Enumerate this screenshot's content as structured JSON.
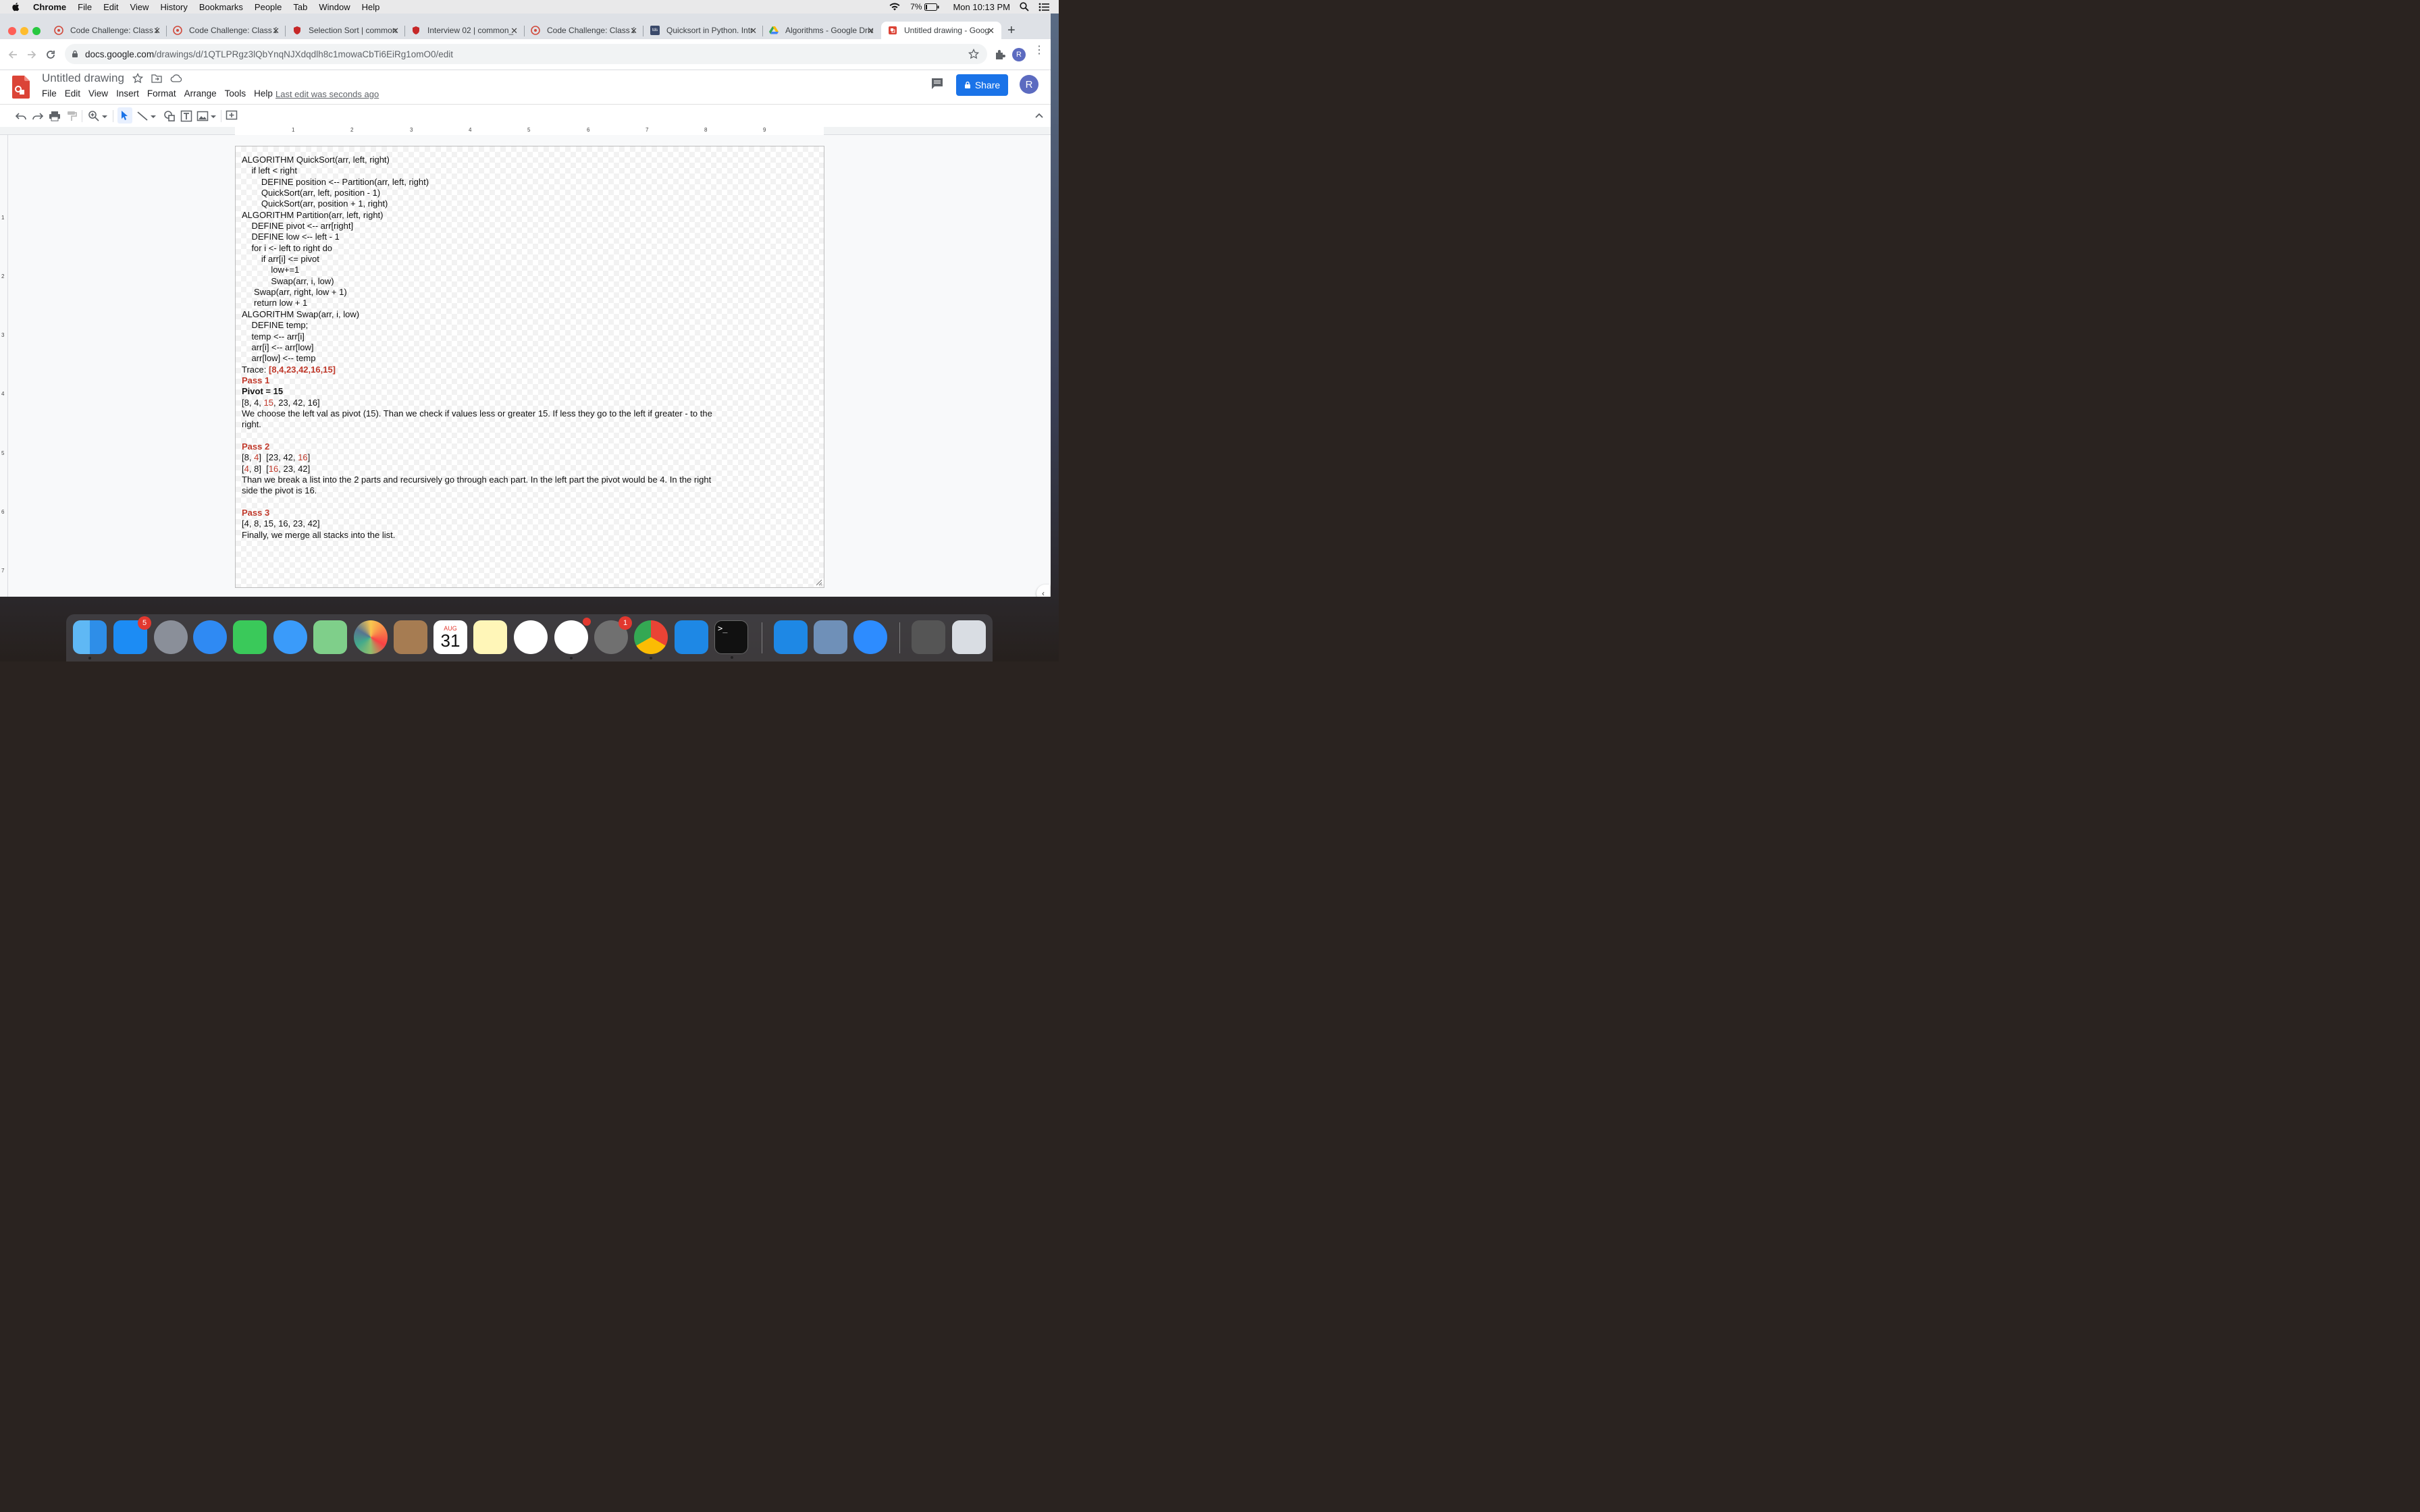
{
  "menubar": {
    "app_name": "Chrome",
    "items": [
      "File",
      "Edit",
      "View",
      "History",
      "Bookmarks",
      "People",
      "Tab",
      "Window",
      "Help"
    ],
    "battery": "7%",
    "clock": "Mon 10:13 PM"
  },
  "tabs": [
    {
      "title": "Code Challenge: Class 2"
    },
    {
      "title": "Code Challenge: Class 2"
    },
    {
      "title": "Selection Sort | common"
    },
    {
      "title": "Interview 02 | common_"
    },
    {
      "title": "Code Challenge: Class 2"
    },
    {
      "title": "Quicksort in Python. Intr"
    },
    {
      "title": "Algorithms - Google Driv"
    },
    {
      "title": "Untitled drawing - Goog"
    }
  ],
  "tab_favicon_badge": "tds",
  "address_bar": {
    "host": "docs.google.com",
    "path": "/drawings/d/1QTLPRgz3lQbYnqNJXdqdlh8c1mowaCbTi6EiRg1omO0/edit"
  },
  "profile_initial": "R",
  "docs": {
    "title": "Untitled drawing",
    "menu": [
      "File",
      "Edit",
      "View",
      "Insert",
      "Format",
      "Arrange",
      "Tools",
      "Help"
    ],
    "last_edit": "Last edit was seconds ago",
    "share_label": "Share",
    "account_initial": "R"
  },
  "ruler": {
    "h_numbers": [
      "1",
      "2",
      "3",
      "4",
      "5",
      "6",
      "7",
      "8",
      "9"
    ],
    "v_numbers": [
      "1",
      "2",
      "3",
      "4",
      "5",
      "6",
      "7"
    ]
  },
  "content": {
    "code_lines": [
      "ALGORITHM QuickSort(arr, left, right)",
      "    if left < right",
      "        DEFINE position <-- Partition(arr, left, right)",
      "        QuickSort(arr, left, position - 1)",
      "        QuickSort(arr, position + 1, right)",
      "ALGORITHM Partition(arr, left, right)",
      "    DEFINE pivot <-- arr[right]",
      "    DEFINE low <-- left - 1",
      "    for i <- left to right do",
      "        if arr[i] <= pivot",
      "            low+=1",
      "            Swap(arr, i, low)",
      "     Swap(arr, right, low + 1)",
      "     return low + 1",
      "ALGORITHM Swap(arr, i, low)",
      "    DEFINE temp;",
      "    temp <-- arr[i]",
      "    arr[i] <-- arr[low]",
      "    arr[low] <-- temp"
    ],
    "trace_label": "Trace: ",
    "trace_value": "[8,4,23,42,16,15]",
    "pass1": {
      "heading": "Pass 1",
      "pivot": "Pivot = 15",
      "list_a": "[8, 4, ",
      "list_hl": "15",
      "list_b": ", 23, 42, 16]",
      "desc_line1": "We choose the left val as pivot (15). Than we check if values less or greater 15. If less they go to the left if greater - to the",
      "desc_line2": "right."
    },
    "pass2": {
      "heading": "Pass 2",
      "row1_a": "[8, ",
      "row1_hl1": "4",
      "row1_b": "]  [23, 42, ",
      "row1_hl2": "16",
      "row1_c": "]",
      "row2_a": "[",
      "row2_hl1": "4",
      "row2_b": ", 8]  [",
      "row2_hl2": "16",
      "row2_c": ", 23, 42]",
      "desc_line1": "Than we break a list into the 2 parts and recursively go through each part. In the left part the pivot would be 4. In the right",
      "desc_line2": "side the pivot is 16."
    },
    "pass3": {
      "heading": "Pass 3",
      "list": "[4, 8, 15, 16, 23, 42]",
      "desc": "Finally, we merge all stacks into the list."
    }
  },
  "dock": {
    "app_store_badge": "5",
    "calendar_month": "AUG",
    "calendar_day": "31",
    "settings_badge": "1"
  },
  "colors": {
    "accent_red": "#c0392b",
    "share_blue": "#1a73e8"
  }
}
